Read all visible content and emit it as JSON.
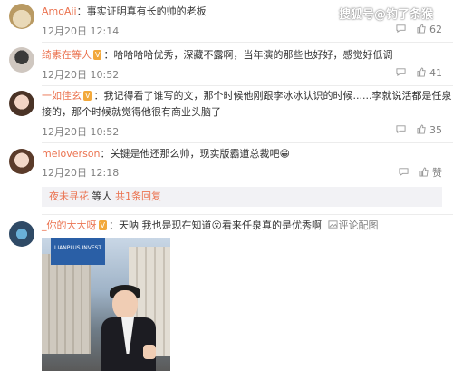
{
  "watermark": "搜狐号@钓了条猴",
  "comments": [
    {
      "user": "AmoAii",
      "text": "：事实证明真有长的帅的老板",
      "time": "12月20日 12:14",
      "likes": "62"
    },
    {
      "user": "绮素在等人",
      "badge": "V",
      "text": "：哈哈哈哈优秀，深藏不露啊，当年演的那些也好好，感觉好低调",
      "time": "12月20日 10:52",
      "likes": "41"
    },
    {
      "user": "一如佳玄",
      "badge": "V",
      "text": "：我记得看了谁写的文，那个时候他刚跟李冰冰认识的时候......李就说活都是任泉",
      "text2": "接的，那个时候就觉得他很有商业头脑了",
      "time": "12月20日 10:52",
      "likes": "35"
    },
    {
      "user": "meloverson",
      "text": "：关键是他还那么帅，现实版霸道总裁吧",
      "emoji": "😁",
      "time": "12月20日 12:18",
      "likes": "赞"
    },
    {
      "user": "_你的大大呀",
      "badge": "V",
      "text": "：天呐 我也是现在知道",
      "emoji": "😮",
      "text_after": "看来任泉真的是优秀啊",
      "picture_label": "评论配图"
    }
  ],
  "reply_box": {
    "user": "夜未寻花",
    "text": " 等人 ",
    "link": "共1条回复"
  },
  "photo": {
    "banner_text": "LIANPLUS INVEST"
  },
  "icons": {
    "comment": "comment-icon",
    "like": "thumbs-up-icon",
    "picture": "picture-icon"
  }
}
